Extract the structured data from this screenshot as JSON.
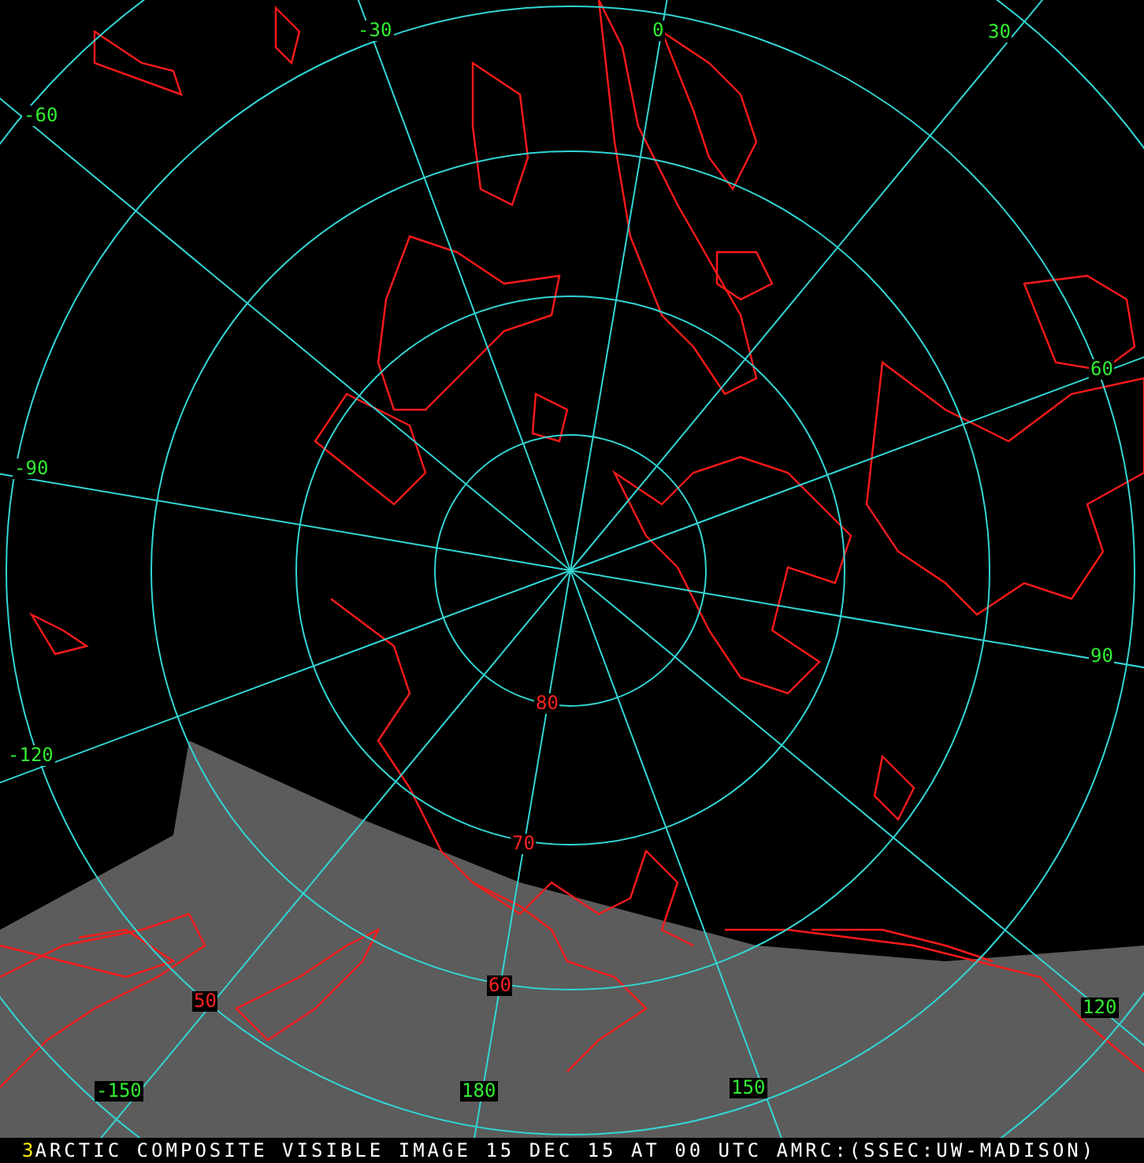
{
  "map": {
    "labels": [
      {
        "kind": "longitude",
        "text": "-30"
      },
      {
        "kind": "longitude",
        "text": "0"
      },
      {
        "kind": "longitude",
        "text": "30"
      },
      {
        "kind": "longitude",
        "text": "-60"
      },
      {
        "kind": "longitude",
        "text": "60"
      },
      {
        "kind": "longitude",
        "text": "-90"
      },
      {
        "kind": "longitude",
        "text": "90"
      },
      {
        "kind": "longitude",
        "text": "-120"
      },
      {
        "kind": "longitude",
        "text": "120"
      },
      {
        "kind": "longitude",
        "text": "-150"
      },
      {
        "kind": "longitude",
        "text": "180"
      },
      {
        "kind": "longitude",
        "text": "150"
      },
      {
        "kind": "latitude",
        "text": "80"
      },
      {
        "kind": "latitude",
        "text": "70"
      },
      {
        "kind": "latitude",
        "text": "60"
      },
      {
        "kind": "latitude",
        "text": "50"
      }
    ]
  },
  "status_bar": {
    "frame_number": "3",
    "caption": "ARCTIC COMPOSITE VISIBLE IMAGE 15 DEC 15 AT 00 UTC AMRC:(SSEC:UW-MADISON)"
  }
}
